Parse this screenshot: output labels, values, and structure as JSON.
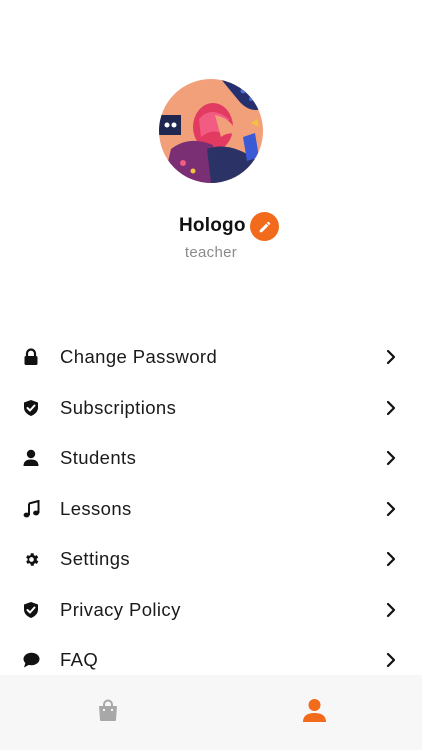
{
  "profile": {
    "name": "Hologo",
    "role": "teacher",
    "avatar_icon": "avatar-illustration",
    "edit_icon": "pencil-icon"
  },
  "menu": {
    "items": [
      {
        "label": "Change Password",
        "icon": "lock-icon"
      },
      {
        "label": "Subscriptions",
        "icon": "shield-check-icon"
      },
      {
        "label": "Students",
        "icon": "user-icon"
      },
      {
        "label": "Lessons",
        "icon": "music-note-icon"
      },
      {
        "label": "Settings",
        "icon": "gear-icon"
      },
      {
        "label": "Privacy Policy",
        "icon": "shield-check-icon"
      },
      {
        "label": "FAQ",
        "icon": "chat-bubble-icon"
      }
    ]
  },
  "tabbar": {
    "tabs": [
      {
        "icon": "shopping-bag-icon",
        "active": false
      },
      {
        "icon": "user-icon",
        "active": true
      }
    ]
  },
  "colors": {
    "accent": "#f26a1b",
    "text": "#1a1a1a",
    "secondary_text": "#8a8a8a",
    "inactive_icon": "#a8a8a8",
    "tabbar_background": "#f6f6f6"
  }
}
